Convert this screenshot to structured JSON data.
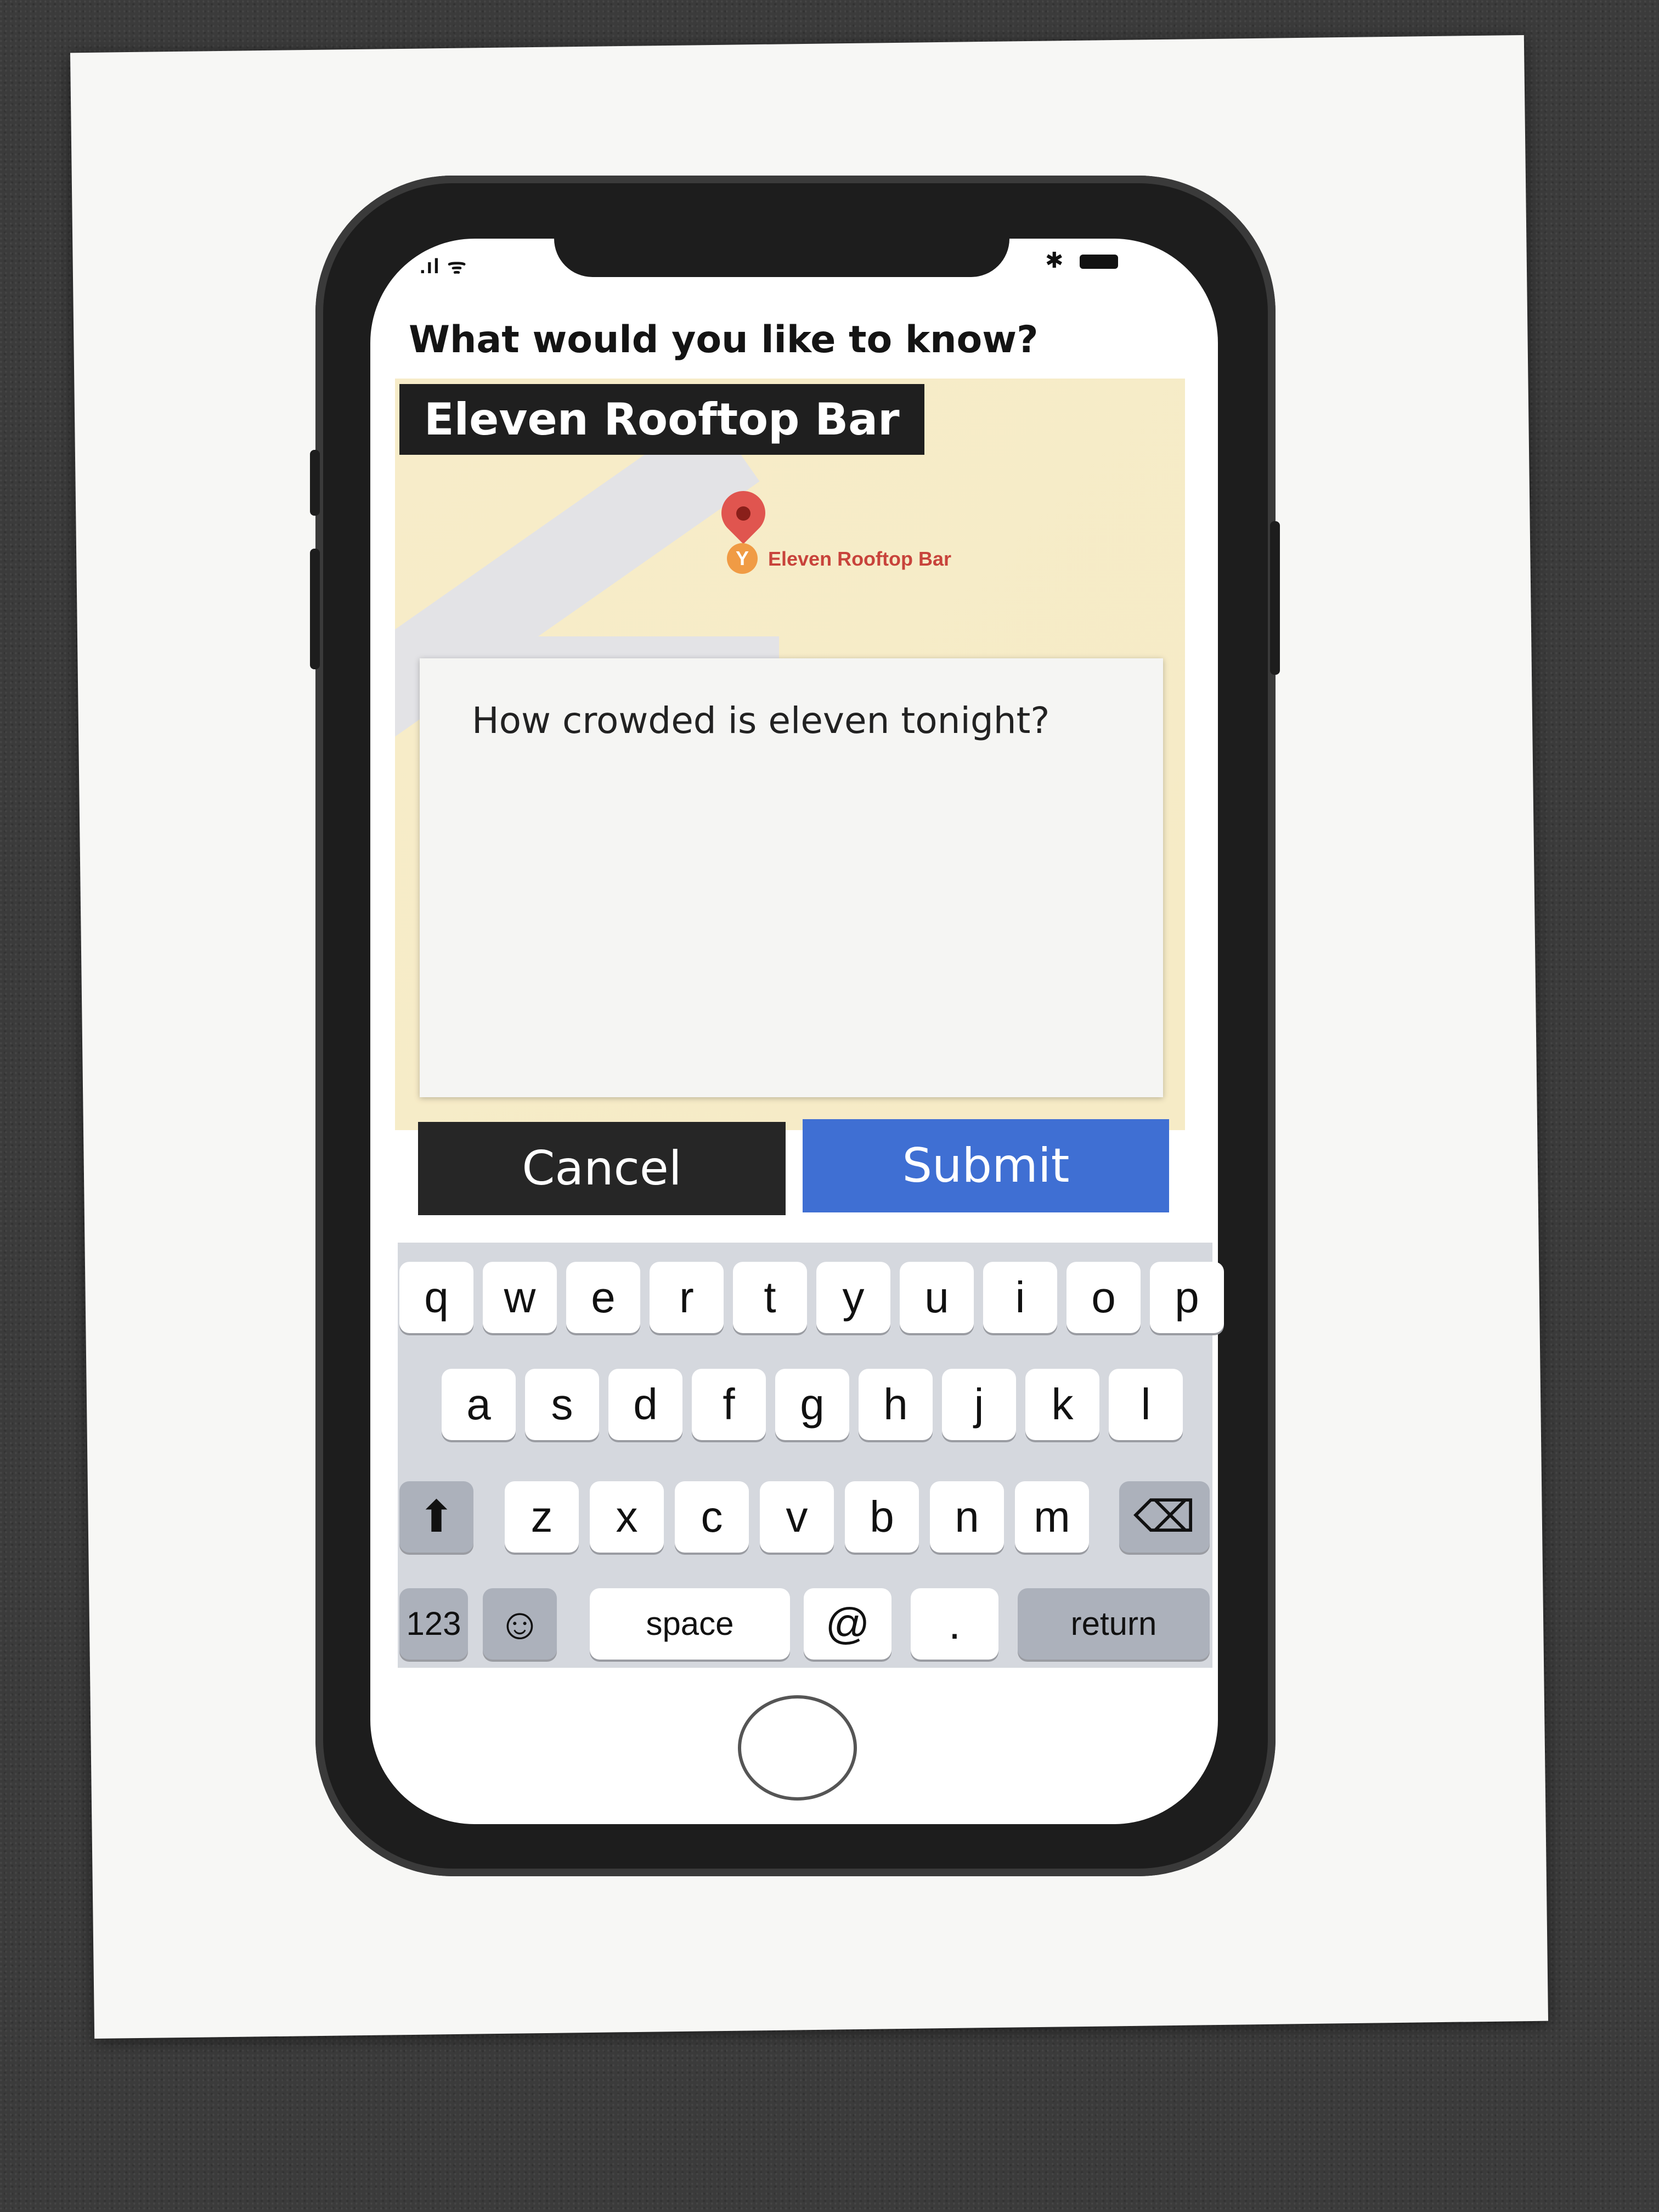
{
  "status": {
    "signal": ".ıl",
    "wifi": "ᯤ",
    "bluetooth": "✱"
  },
  "header": {
    "question": "What would you like to know?"
  },
  "map": {
    "title": "Eleven Rooftop Bar",
    "pin_label": "Eleven Rooftop Bar",
    "place_icon": "Y"
  },
  "form": {
    "query": "How crowded is eleven tonight?"
  },
  "actions": {
    "cancel": "Cancel",
    "submit": "Submit"
  },
  "keyboard": {
    "row1": [
      "q",
      "w",
      "e",
      "r",
      "t",
      "y",
      "u",
      "i",
      "o",
      "p"
    ],
    "row2": [
      "a",
      "s",
      "d",
      "f",
      "g",
      "h",
      "j",
      "k",
      "l"
    ],
    "row3": [
      "z",
      "x",
      "c",
      "v",
      "b",
      "n",
      "m"
    ],
    "shift": "⬆",
    "delete": "⌫",
    "numbers": "123",
    "emoji": "☺",
    "space": "space",
    "at": "@",
    "period": ".",
    "return": "return"
  },
  "colors": {
    "submit": "#3f6fd3",
    "cancel": "#262626",
    "pin": "#e0554f"
  }
}
